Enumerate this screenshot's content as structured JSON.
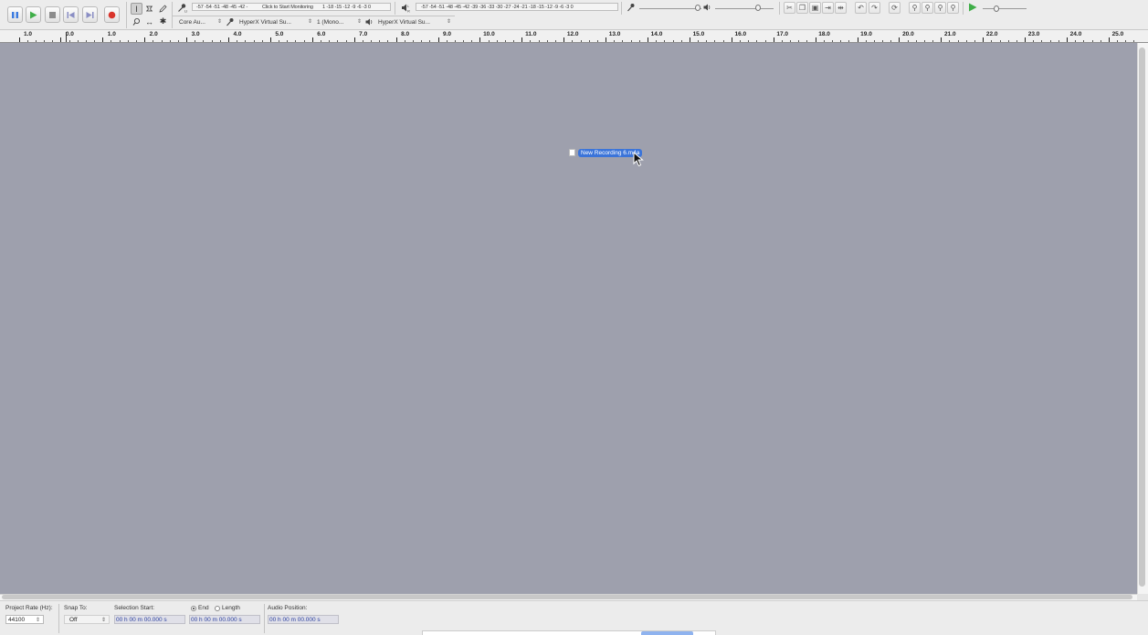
{
  "transport": {
    "buttons": [
      {
        "id": "pause",
        "color": "#3b7be0"
      },
      {
        "id": "play",
        "color": "#3fae48"
      },
      {
        "id": "stop",
        "color": "#777777"
      },
      {
        "id": "skip-start",
        "color": "#8a8ec4"
      },
      {
        "id": "skip-end",
        "color": "#8a8ec4"
      },
      {
        "id": "record",
        "color": "#d9352c"
      }
    ]
  },
  "meters": {
    "record_scale": "-57 -54 -51 -48 -45 -42 -",
    "record_hint": "Click to Start Monitoring",
    "record_scale_tail": "1 -18 -15 -12 -9 -6 -3 0",
    "playback_channels": "L R",
    "playback_scale": "-57 -54 -51 -48 -45 -42 -39 -36 -33 -30 -27 -24 -21 -18 -15 -12 -9 -6 -3 0"
  },
  "devices": {
    "host": "Core Au...",
    "recording_device": "HyperX Virtual Su...",
    "channels": "1 (Mono...",
    "playback_device": "HyperX Virtual Su..."
  },
  "ruler": {
    "labels": [
      "1.0",
      "0.0",
      "1.0",
      "2.0",
      "3.0",
      "4.0",
      "5.0",
      "6.0",
      "7.0",
      "8.0",
      "9.0",
      "10.0",
      "11.0",
      "12.0",
      "13.0",
      "14.0",
      "15.0",
      "16.0",
      "17.0",
      "18.0",
      "19.0",
      "20.0",
      "21.0",
      "22.0",
      "23.0",
      "24.0",
      "25.0"
    ]
  },
  "drag": {
    "label": "New Recording 6.m4a"
  },
  "status": {
    "project_rate_label": "Project Rate (Hz):",
    "project_rate_value": "44100",
    "snap_to_label": "Snap To:",
    "snap_to_value": "Off",
    "selection_start_label": "Selection Start:",
    "end_label": "End",
    "length_label": "Length",
    "audio_position_label": "Audio Position:",
    "selection_start_value": "00 h 00 m 00.000 s",
    "selection_end_value": "00 h 00 m 00.000 s",
    "audio_position_value": "00 h 00 m 00.000 s"
  },
  "colors": {
    "track_area": "#9ea0ad",
    "accent": "#3b74d9"
  }
}
